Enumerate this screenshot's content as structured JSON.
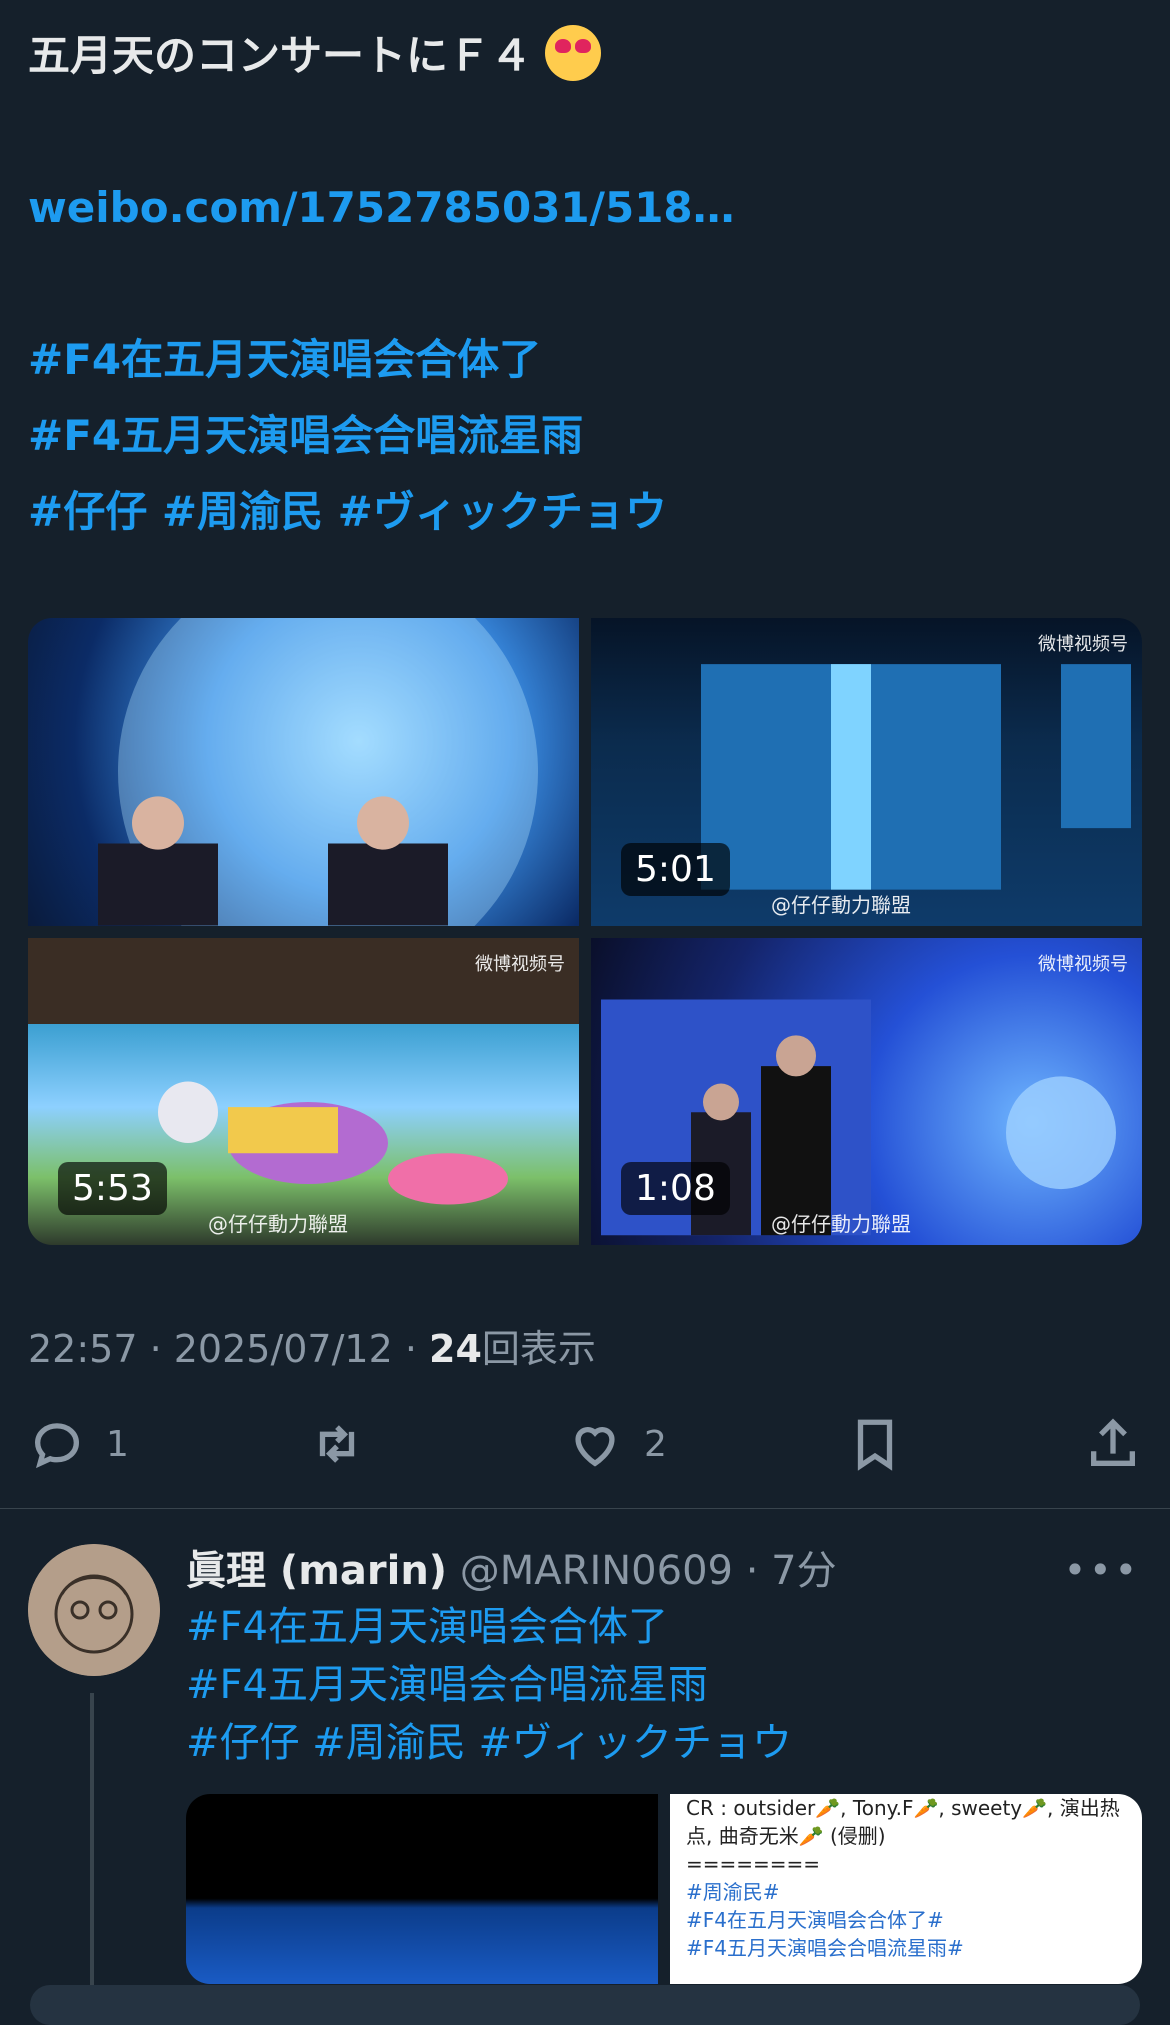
{
  "tweet": {
    "title": "五月天のコンサートにＦ４",
    "link": "weibo.com/1752785031/518…",
    "hashtags_line1": "#F4在五月天演唱会合体了",
    "hashtags_line2": "#F4五月天演唱会合唱流星雨",
    "hashtags_line3": "#仔仔 #周渝民 #ヴィックチョウ",
    "media": [
      {
        "duration": "",
        "watermark": ""
      },
      {
        "duration": "5:01",
        "watermark": "@仔仔動力聯盟",
        "corner": "微博视频号"
      },
      {
        "duration": "5:53",
        "watermark": "@仔仔動力聯盟",
        "corner": "微博视频号"
      },
      {
        "duration": "1:08",
        "watermark": "@仔仔動力聯盟",
        "corner": "微博视频号"
      }
    ],
    "time": "22:57 · 2025/07/12 · ",
    "views_count": "24",
    "views_label": "回表示",
    "actions": {
      "reply_count": "1",
      "retweet_count": "",
      "like_count": "2"
    }
  },
  "reply": {
    "name": "眞理 (marin)",
    "handle": "@MARIN0609 · 7分",
    "hashtags_line1": "#F4在五月天演唱会合体了",
    "hashtags_line2": "#F4五月天演唱会合唱流星雨",
    "hashtags_line3": "#仔仔 #周渝民 #ヴィックチョウ",
    "media_text": {
      "line1": "CR : outsider🥕, Tony.F🥕, sweety🥕, 演出热",
      "line2": "点, 曲奇无米🥕 (侵删)",
      "line3": "========",
      "line4": "#周渝民#",
      "line5": "#F4在五月天演唱会合体了#",
      "line6": "#F4五月天演唱会合唱流星雨#"
    }
  },
  "colors": {
    "background": "#15202b",
    "link": "#1d9bf0",
    "muted": "#8b98a5"
  }
}
